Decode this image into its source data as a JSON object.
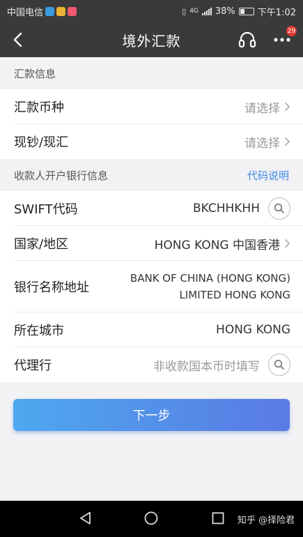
{
  "status_bar": {
    "carrier": "中国电信",
    "battery": "38%",
    "time": "下午1:02",
    "network": "4G"
  },
  "nav": {
    "title": "境外汇款",
    "badge_count": "29",
    "icons": [
      "back-arrow-icon",
      "headset-icon",
      "more-icon"
    ]
  },
  "remittance_section": {
    "header": "汇款信息",
    "rows": [
      {
        "label": "汇款币种",
        "value": "请选择"
      },
      {
        "label": "现钞/现汇",
        "value": "请选择"
      }
    ]
  },
  "bank_section": {
    "header": "收款人开户银行信息",
    "link": "代码说明",
    "swift": {
      "label": "SWIFT代码",
      "value": "BKCHHKHH"
    },
    "country": {
      "label": "国家/地区",
      "value": "HONG KONG 中国香港"
    },
    "bank_name": {
      "label": "银行名称地址",
      "line1": "BANK OF CHINA (HONG KONG)",
      "line2": "LIMITED HONG KONG"
    },
    "city": {
      "label": "所在城市",
      "value": "HONG KONG"
    },
    "agent": {
      "label": "代理行",
      "placeholder": "非收款国本币时填写"
    }
  },
  "next_button": "下一步",
  "watermark": "知乎 @择险君",
  "colors": {
    "nav_bg": "#3a3a3a",
    "link": "#3c8be8",
    "button_start": "#4ea8ef",
    "button_end": "#5a7ae4"
  }
}
